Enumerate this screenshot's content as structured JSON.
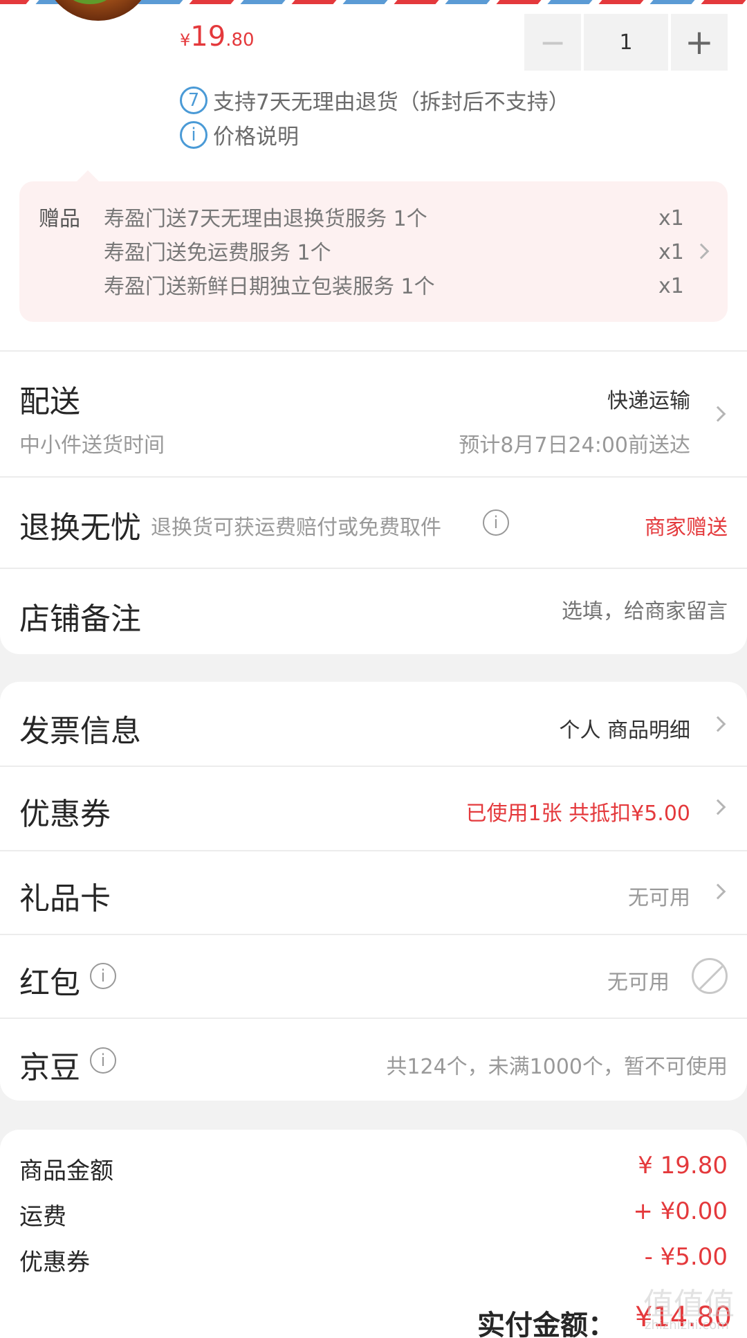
{
  "product": {
    "price_currency": "¥",
    "price_integer": "19",
    "price_decimal": ".80",
    "quantity": "1",
    "minus_symbol": "−",
    "plus_symbol": "+",
    "return_badge": "7",
    "return_policy": "支持7天无理由退货（拆封后不支持）",
    "info_symbol": "i",
    "price_note": "价格说明"
  },
  "gifts": {
    "label": "赠品",
    "items": [
      {
        "name": "寿盈门送7天无理由退换货服务 1个",
        "qty": "x1"
      },
      {
        "name": "寿盈门送免运费服务 1个",
        "qty": "x1"
      },
      {
        "name": "寿盈门送新鲜日期独立包装服务 1个",
        "qty": "x1"
      }
    ]
  },
  "delivery": {
    "title": "配送",
    "method": "快递运输",
    "subtitle": "中小件送货时间",
    "eta": "预计8月7日24:00前送达"
  },
  "return_worry_free": {
    "title": "退换无忧",
    "desc": "退换货可获运费赔付或免费取件",
    "value": "商家赠送"
  },
  "store_note": {
    "title": "店铺备注",
    "placeholder": "选填，给商家留言"
  },
  "invoice": {
    "title": "发票信息",
    "value": "个人 商品明细"
  },
  "coupon": {
    "title": "优惠券",
    "value": "已使用1张 共抵扣¥5.00"
  },
  "gift_card": {
    "title": "礼品卡",
    "value": "无可用"
  },
  "red_packet": {
    "title": "红包",
    "value": "无可用"
  },
  "jd_beans": {
    "title": "京豆",
    "value": "共124个，未满1000个，暂不可使用"
  },
  "summary": {
    "goods_label": "商品金额",
    "goods_value": "¥ 19.80",
    "shipping_label": "运费",
    "shipping_value": "+ ¥0.00",
    "coupon_label": "优惠券",
    "coupon_value": "- ¥5.00",
    "pay_label": "实付金额：",
    "pay_value": "¥14.80"
  },
  "watermark": {
    "text": "值值值",
    "sub": "zhizhizhi.com"
  },
  "colors": {
    "accent_red": "#e4393c",
    "info_blue": "#4a9ad6",
    "gift_bg": "#fdf1f1",
    "page_bg": "#f2f2f2",
    "airmail_red": "#e4393c",
    "airmail_blue": "#5b9bd5"
  }
}
